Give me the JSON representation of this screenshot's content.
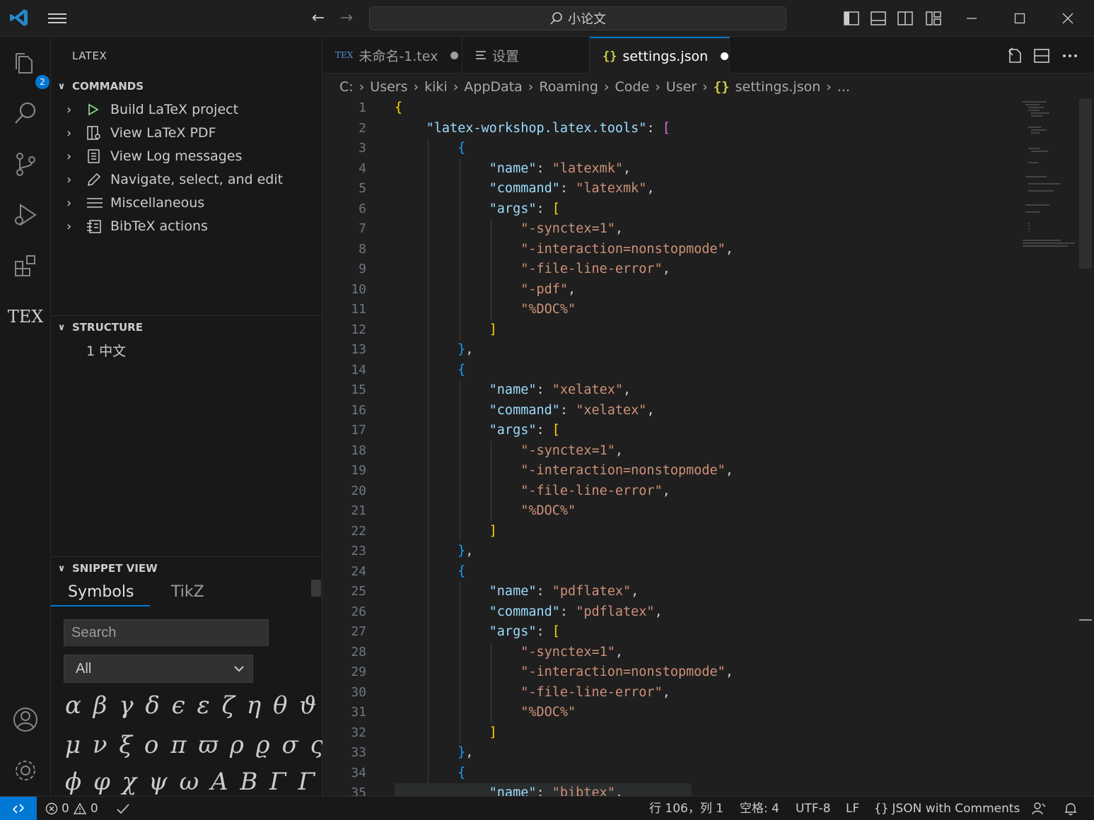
{
  "titlebar": {
    "search_text": "小论文",
    "back_icon": "arrow-left-icon",
    "forward_icon": "arrow-right-icon"
  },
  "activity": {
    "explorer_badge": "2",
    "tex_label": "TEX"
  },
  "sidebar": {
    "title": "LATEX",
    "commands_header": "COMMANDS",
    "commands": [
      {
        "label": "Build LaTeX project",
        "icon": "play-icon"
      },
      {
        "label": "View LaTeX PDF",
        "icon": "view-pdf-icon"
      },
      {
        "label": "View Log messages",
        "icon": "log-icon"
      },
      {
        "label": "Navigate, select, and edit",
        "icon": "pencil-icon"
      },
      {
        "label": "Miscellaneous",
        "icon": "list-icon"
      },
      {
        "label": "BibTeX actions",
        "icon": "bibtex-icon"
      }
    ],
    "structure_header": "STRUCTURE",
    "structure_item": "1 中文",
    "snippet_header": "SNIPPET VIEW",
    "snippet_tabs": [
      "Symbols",
      "TikZ"
    ],
    "search_placeholder": "Search",
    "filter_value": "All",
    "symbol_rows": [
      "α β γ δ ϵ ε ζ η θ ϑ ι κ λ",
      "μ ν ξ ο π ϖ ρ ϱ σ ς τ υ",
      "ϕ φ χ ψ ω Α Β Γ Γ Δ"
    ]
  },
  "tabs": [
    {
      "label": "未命名-1.tex",
      "icon": "tex-file-icon",
      "modified": true
    },
    {
      "label": "设置",
      "icon": "settings-list-icon",
      "modified": false
    },
    {
      "label": "settings.json",
      "icon": "json-braces-icon",
      "modified": true
    }
  ],
  "breadcrumb": [
    "C:",
    "Users",
    "kiki",
    "AppData",
    "Roaming",
    "Code",
    "User",
    "settings.json",
    "..."
  ],
  "editor": {
    "colors": {
      "key": "#9cdcfe",
      "string": "#ce9178",
      "bracket1": "#ffd700",
      "bracket2": "#da70d6",
      "bracket3": "#179fff"
    },
    "line_numbers": [
      "1",
      "2",
      "3",
      "4",
      "5",
      "6",
      "7",
      "8",
      "9",
      "10",
      "11",
      "12",
      "13",
      "14",
      "15",
      "16",
      "17",
      "18",
      "19",
      "20",
      "21",
      "22",
      "23",
      "24",
      "25",
      "26",
      "27",
      "28",
      "29",
      "30",
      "31",
      "32",
      "33",
      "34",
      "35"
    ]
  },
  "statusbar": {
    "errors": "0",
    "warnings": "0",
    "position": "行 106，列 1",
    "spaces": "空格: 4",
    "encoding": "UTF-8",
    "eol": "LF",
    "language": "JSON with Comments"
  }
}
